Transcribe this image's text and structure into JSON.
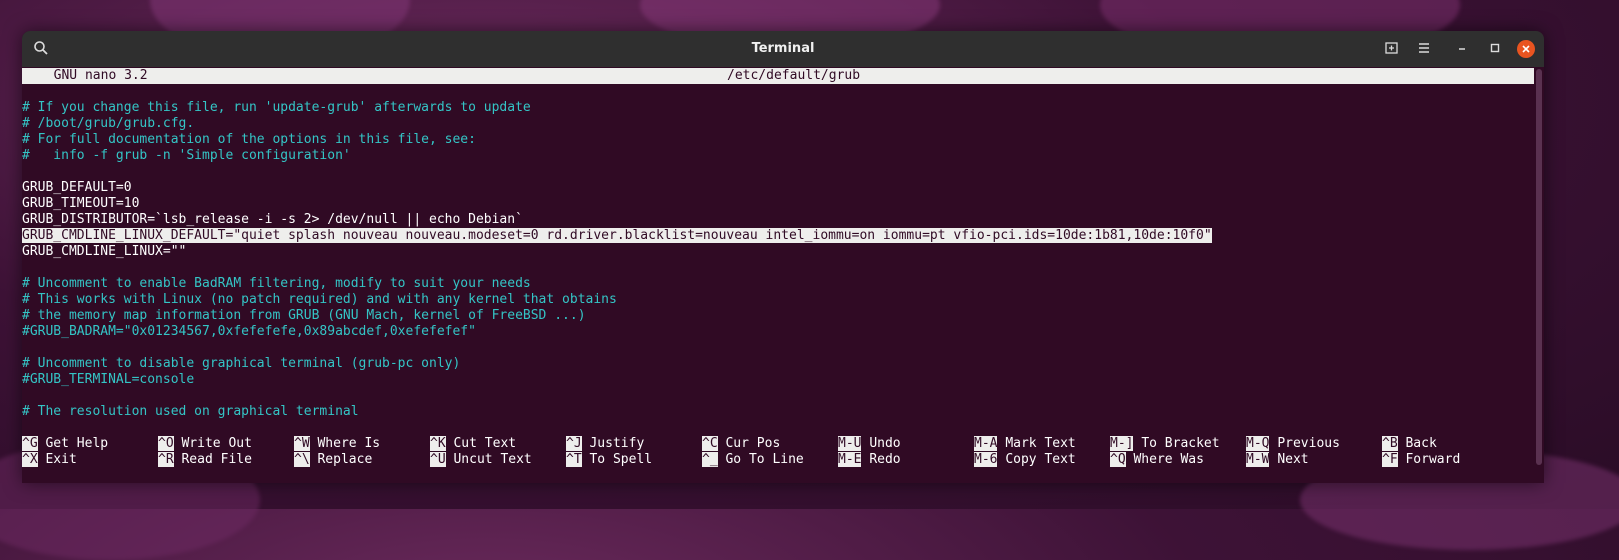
{
  "window": {
    "title": "Terminal"
  },
  "nano": {
    "version": "  GNU nano 3.2",
    "filename": "/etc/default/grub"
  },
  "lines": [
    {
      "text": "# If you change this file, run 'update-grub' afterwards to update",
      "type": "comment"
    },
    {
      "text": "# /boot/grub/grub.cfg.",
      "type": "comment"
    },
    {
      "text": "# For full documentation of the options in this file, see:",
      "type": "comment"
    },
    {
      "text": "#   info -f grub -n 'Simple configuration'",
      "type": "comment"
    },
    {
      "text": "",
      "type": "blank"
    },
    {
      "text": "GRUB_DEFAULT=0",
      "type": "code"
    },
    {
      "text": "GRUB_TIMEOUT=10",
      "type": "code"
    },
    {
      "text": "GRUB_DISTRIBUTOR=`lsb_release -i -s 2> /dev/null || echo Debian`",
      "type": "code"
    },
    {
      "text": "GRUB_CMDLINE_LINUX_DEFAULT=\"quiet splash nouveau nouveau.modeset=0 rd.driver.blacklist=nouveau intel_iommu=on iommu=pt vfio-pci.ids=10de:1b81,10de:10f0\"",
      "type": "highlight"
    },
    {
      "text": "GRUB_CMDLINE_LINUX=\"\"",
      "type": "code"
    },
    {
      "text": "",
      "type": "blank"
    },
    {
      "text": "# Uncomment to enable BadRAM filtering, modify to suit your needs",
      "type": "comment"
    },
    {
      "text": "# This works with Linux (no patch required) and with any kernel that obtains",
      "type": "comment"
    },
    {
      "text": "# the memory map information from GRUB (GNU Mach, kernel of FreeBSD ...)",
      "type": "comment"
    },
    {
      "text": "#GRUB_BADRAM=\"0x01234567,0xfefefefe,0x89abcdef,0xefefefef\"",
      "type": "comment"
    },
    {
      "text": "",
      "type": "blank"
    },
    {
      "text": "# Uncomment to disable graphical terminal (grub-pc only)",
      "type": "comment"
    },
    {
      "text": "#GRUB_TERMINAL=console",
      "type": "comment"
    },
    {
      "text": "",
      "type": "blank"
    },
    {
      "text": "# The resolution used on graphical terminal",
      "type": "comment"
    }
  ],
  "shortcuts": [
    [
      {
        "key": "^G",
        "label": "Get Help"
      },
      {
        "key": "^O",
        "label": "Write Out"
      },
      {
        "key": "^W",
        "label": "Where Is"
      },
      {
        "key": "^K",
        "label": "Cut Text"
      },
      {
        "key": "^J",
        "label": "Justify"
      },
      {
        "key": "^C",
        "label": "Cur Pos"
      },
      {
        "key": "M-U",
        "label": "Undo"
      },
      {
        "key": "M-A",
        "label": "Mark Text"
      },
      {
        "key": "M-]",
        "label": "To Bracket"
      },
      {
        "key": "M-Q",
        "label": "Previous"
      },
      {
        "key": "^B",
        "label": "Back"
      }
    ],
    [
      {
        "key": "^X",
        "label": "Exit"
      },
      {
        "key": "^R",
        "label": "Read File"
      },
      {
        "key": "^\\",
        "label": "Replace"
      },
      {
        "key": "^U",
        "label": "Uncut Text"
      },
      {
        "key": "^T",
        "label": "To Spell"
      },
      {
        "key": "^_",
        "label": "Go To Line"
      },
      {
        "key": "M-E",
        "label": "Redo"
      },
      {
        "key": "M-6",
        "label": "Copy Text"
      },
      {
        "key": "^Q",
        "label": "Where Was"
      },
      {
        "key": "M-W",
        "label": "Next"
      },
      {
        "key": "^F",
        "label": "Forward"
      }
    ]
  ],
  "colors": {
    "terminal_bg": "#300a24",
    "comment": "#34c5c6",
    "accent": "#e95420"
  },
  "icons": {
    "search": "search-icon",
    "new_tab": "new-tab-icon",
    "menu": "hamburger-menu-icon",
    "minimize": "minimize-icon",
    "maximize": "maximize-icon",
    "close": "close-icon"
  }
}
